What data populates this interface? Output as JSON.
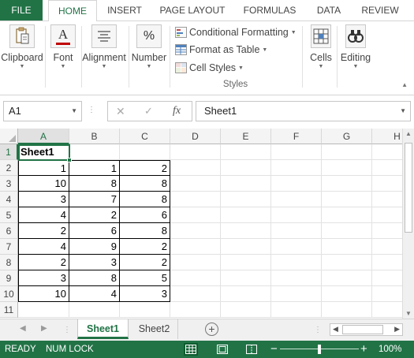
{
  "tabs": {
    "file": "FILE",
    "home": "HOME",
    "insert": "INSERT",
    "page_layout": "PAGE LAYOUT",
    "formulas": "FORMULAS",
    "data": "DATA",
    "review": "REVIEW"
  },
  "ribbon": {
    "clipboard": "Clipboard",
    "font": "Font",
    "alignment": "Alignment",
    "number": "Number",
    "conditional_formatting": "Conditional Formatting",
    "format_as_table": "Format as Table",
    "cell_styles": "Cell Styles",
    "styles_group": "Styles",
    "cells": "Cells",
    "editing": "Editing",
    "font_icon_letter": "A",
    "number_icon_symbol": "%"
  },
  "formula_bar": {
    "name_box": "A1",
    "content": "Sheet1"
  },
  "columns": [
    "A",
    "B",
    "C",
    "D",
    "E",
    "F",
    "G",
    "H"
  ],
  "rows": [
    "1",
    "2",
    "3",
    "4",
    "5",
    "6",
    "7",
    "8",
    "9",
    "10",
    "11"
  ],
  "cells": {
    "a1": "Sheet1",
    "data": [
      [
        "1",
        "1",
        "2"
      ],
      [
        "10",
        "8",
        "8"
      ],
      [
        "3",
        "7",
        "8"
      ],
      [
        "4",
        "2",
        "6"
      ],
      [
        "2",
        "6",
        "8"
      ],
      [
        "4",
        "9",
        "2"
      ],
      [
        "2",
        "3",
        "2"
      ],
      [
        "3",
        "8",
        "5"
      ],
      [
        "10",
        "4",
        "3"
      ]
    ]
  },
  "sheets": [
    "Sheet1",
    "Sheet2"
  ],
  "active_sheet": "Sheet1",
  "status": {
    "ready": "READY",
    "num_lock": "NUM LOCK",
    "zoom": "100%",
    "zoom_fraction": 0.5
  },
  "colors": {
    "accent": "#217346",
    "status_bar": "#217346"
  },
  "icons": [
    "clipboard-icon",
    "font-icon",
    "alignment-icon",
    "number-icon",
    "conditional-formatting-icon",
    "format-as-table-icon",
    "cell-styles-icon",
    "cells-icon",
    "editing-icon",
    "add-sheet-icon"
  ]
}
